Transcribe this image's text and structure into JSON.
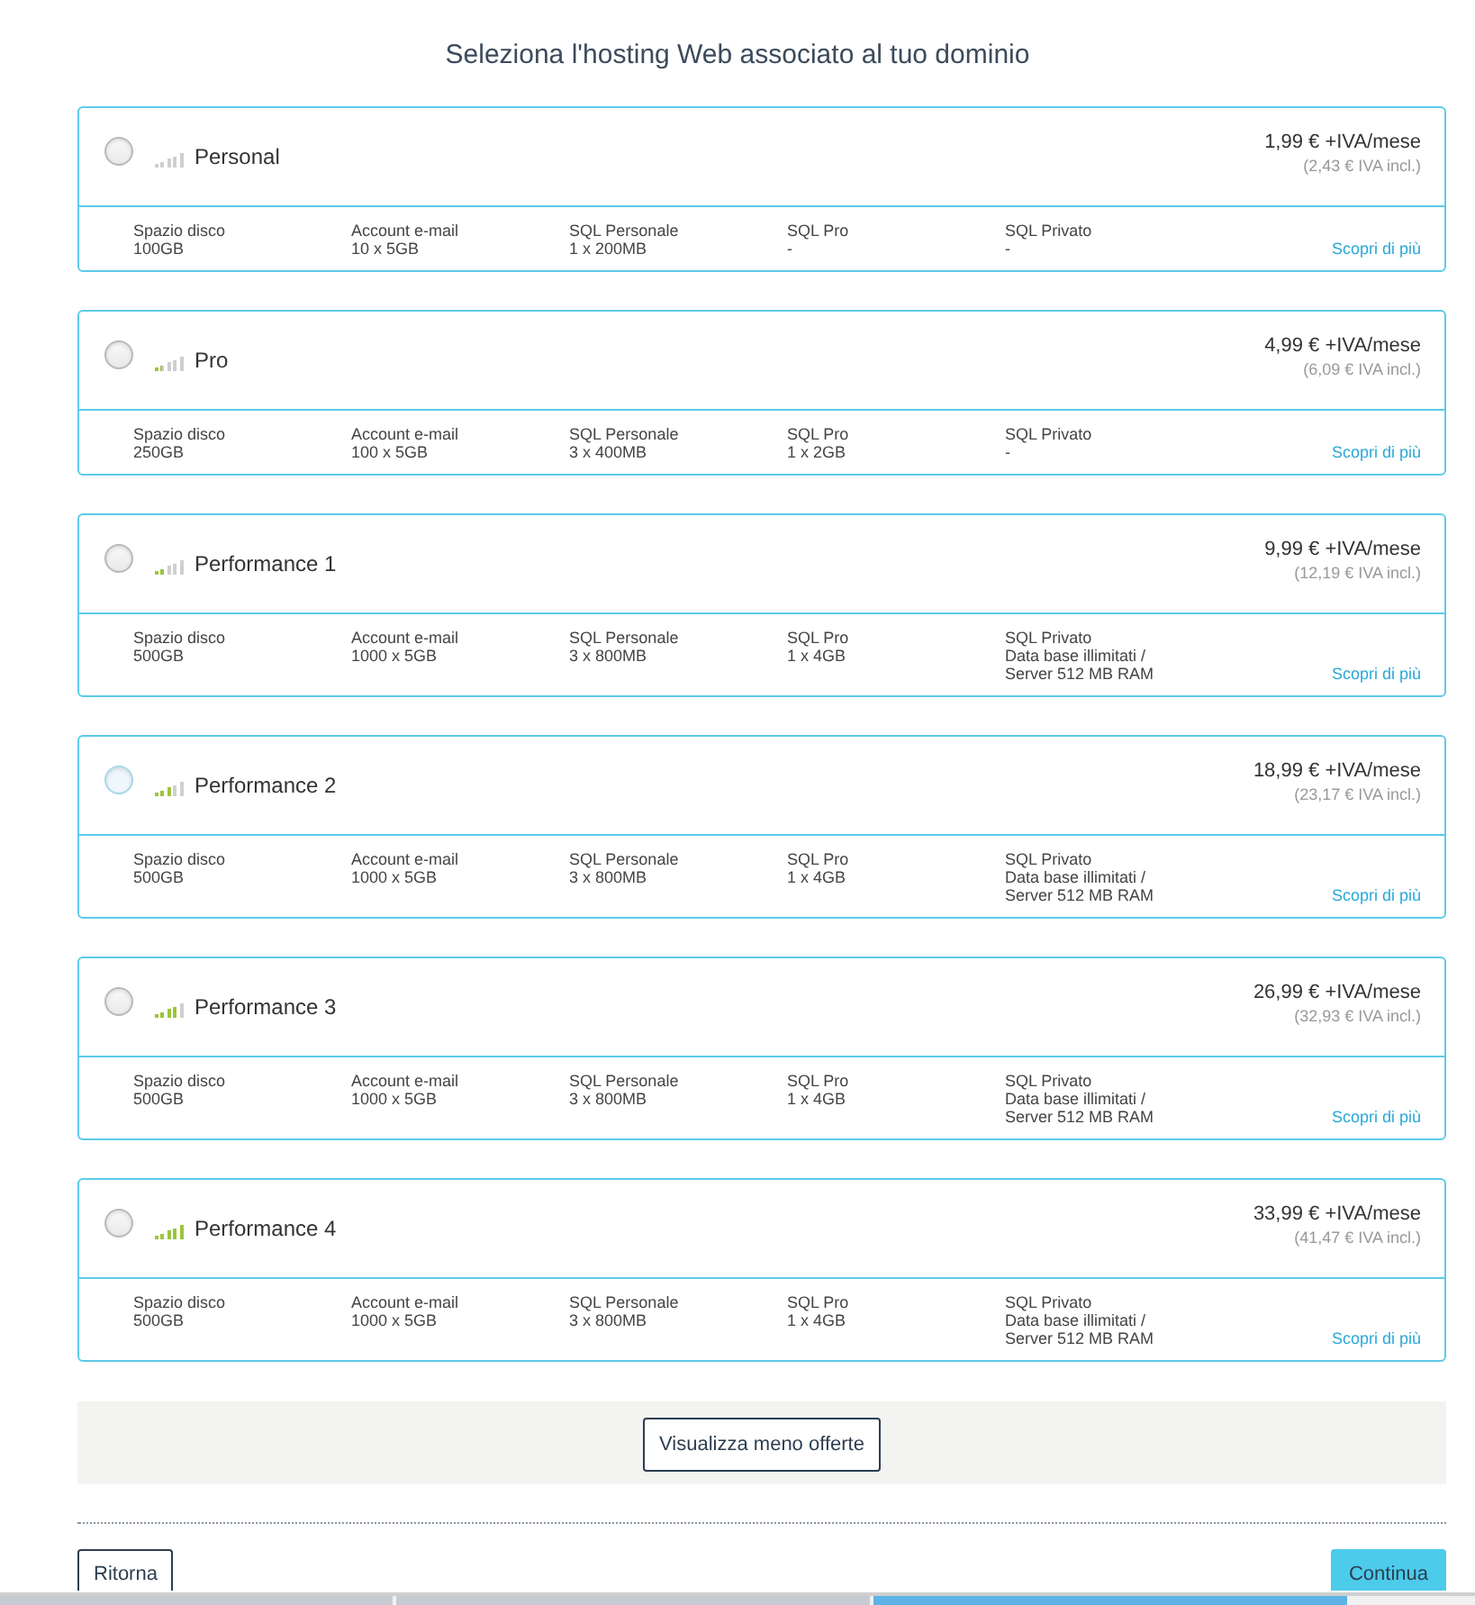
{
  "title": "Seleziona l'hosting Web associato al tuo dominio",
  "plans": [
    {
      "name": "Personal",
      "selected": false,
      "focused": false,
      "level": 0,
      "price": "1,99 € +IVA/mese",
      "price_incl": "(2,43 € IVA incl.)",
      "specs": [
        {
          "label": "Spazio disco",
          "value": "100GB"
        },
        {
          "label": "Account e-mail",
          "value": "10 x 5GB"
        },
        {
          "label": "SQL Personale",
          "value": "1 x 200MB"
        },
        {
          "label": "SQL Pro",
          "value": "-"
        },
        {
          "label": "SQL Privato",
          "value": "-"
        }
      ],
      "link": "Scopri di più"
    },
    {
      "name": "Pro",
      "selected": false,
      "focused": false,
      "level": 0.2,
      "price": "4,99 € +IVA/mese",
      "price_incl": "(6,09 € IVA incl.)",
      "specs": [
        {
          "label": "Spazio disco",
          "value": "250GB"
        },
        {
          "label": "Account e-mail",
          "value": "100 x 5GB"
        },
        {
          "label": "SQL Personale",
          "value": "3 x 400MB"
        },
        {
          "label": "SQL Pro",
          "value": "1 x 2GB"
        },
        {
          "label": "SQL Privato",
          "value": "-"
        }
      ],
      "link": "Scopri di più"
    },
    {
      "name": "Performance 1",
      "selected": false,
      "focused": false,
      "level": 0.4,
      "price": "9,99 € +IVA/mese",
      "price_incl": "(12,19 € IVA incl.)",
      "specs": [
        {
          "label": "Spazio disco",
          "value": "500GB"
        },
        {
          "label": "Account e-mail",
          "value": "1000 x 5GB"
        },
        {
          "label": "SQL Personale",
          "value": "3 x 800MB"
        },
        {
          "label": "SQL Pro",
          "value": "1 x 4GB"
        },
        {
          "label": "SQL Privato",
          "value": "Data base illimitati / Server 512 MB RAM"
        }
      ],
      "link": "Scopri di più"
    },
    {
      "name": "Performance 2",
      "selected": false,
      "focused": true,
      "level": 0.6,
      "price": "18,99 € +IVA/mese",
      "price_incl": "(23,17 € IVA incl.)",
      "specs": [
        {
          "label": "Spazio disco",
          "value": "500GB"
        },
        {
          "label": "Account e-mail",
          "value": "1000 x 5GB"
        },
        {
          "label": "SQL Personale",
          "value": "3 x 800MB"
        },
        {
          "label": "SQL Pro",
          "value": "1 x 4GB"
        },
        {
          "label": "SQL Privato",
          "value": "Data base illimitati / Server 512 MB RAM"
        }
      ],
      "link": "Scopri di più"
    },
    {
      "name": "Performance 3",
      "selected": false,
      "focused": false,
      "level": 0.8,
      "price": "26,99 € +IVA/mese",
      "price_incl": "(32,93 € IVA incl.)",
      "specs": [
        {
          "label": "Spazio disco",
          "value": "500GB"
        },
        {
          "label": "Account e-mail",
          "value": "1000 x 5GB"
        },
        {
          "label": "SQL Personale",
          "value": "3 x 800MB"
        },
        {
          "label": "SQL Pro",
          "value": "1 x 4GB"
        },
        {
          "label": "SQL Privato",
          "value": "Data base illimitati / Server 512 MB RAM"
        }
      ],
      "link": "Scopri di più"
    },
    {
      "name": "Performance 4",
      "selected": false,
      "focused": false,
      "level": 1,
      "price": "33,99 € +IVA/mese",
      "price_incl": "(41,47 € IVA incl.)",
      "specs": [
        {
          "label": "Spazio disco",
          "value": "500GB"
        },
        {
          "label": "Account e-mail",
          "value": "1000 x 5GB"
        },
        {
          "label": "SQL Personale",
          "value": "3 x 800MB"
        },
        {
          "label": "SQL Pro",
          "value": "1 x 4GB"
        },
        {
          "label": "SQL Privato",
          "value": "Data base illimitati / Server 512 MB RAM"
        }
      ],
      "link": "Scopri di più"
    }
  ],
  "toggle_button": "Visualizza meno offerte",
  "back_button": "Ritorna",
  "next_button": "Continua",
  "progress_steps": [
    {
      "selected": false
    },
    {
      "selected": false
    },
    {
      "selected": true
    }
  ]
}
